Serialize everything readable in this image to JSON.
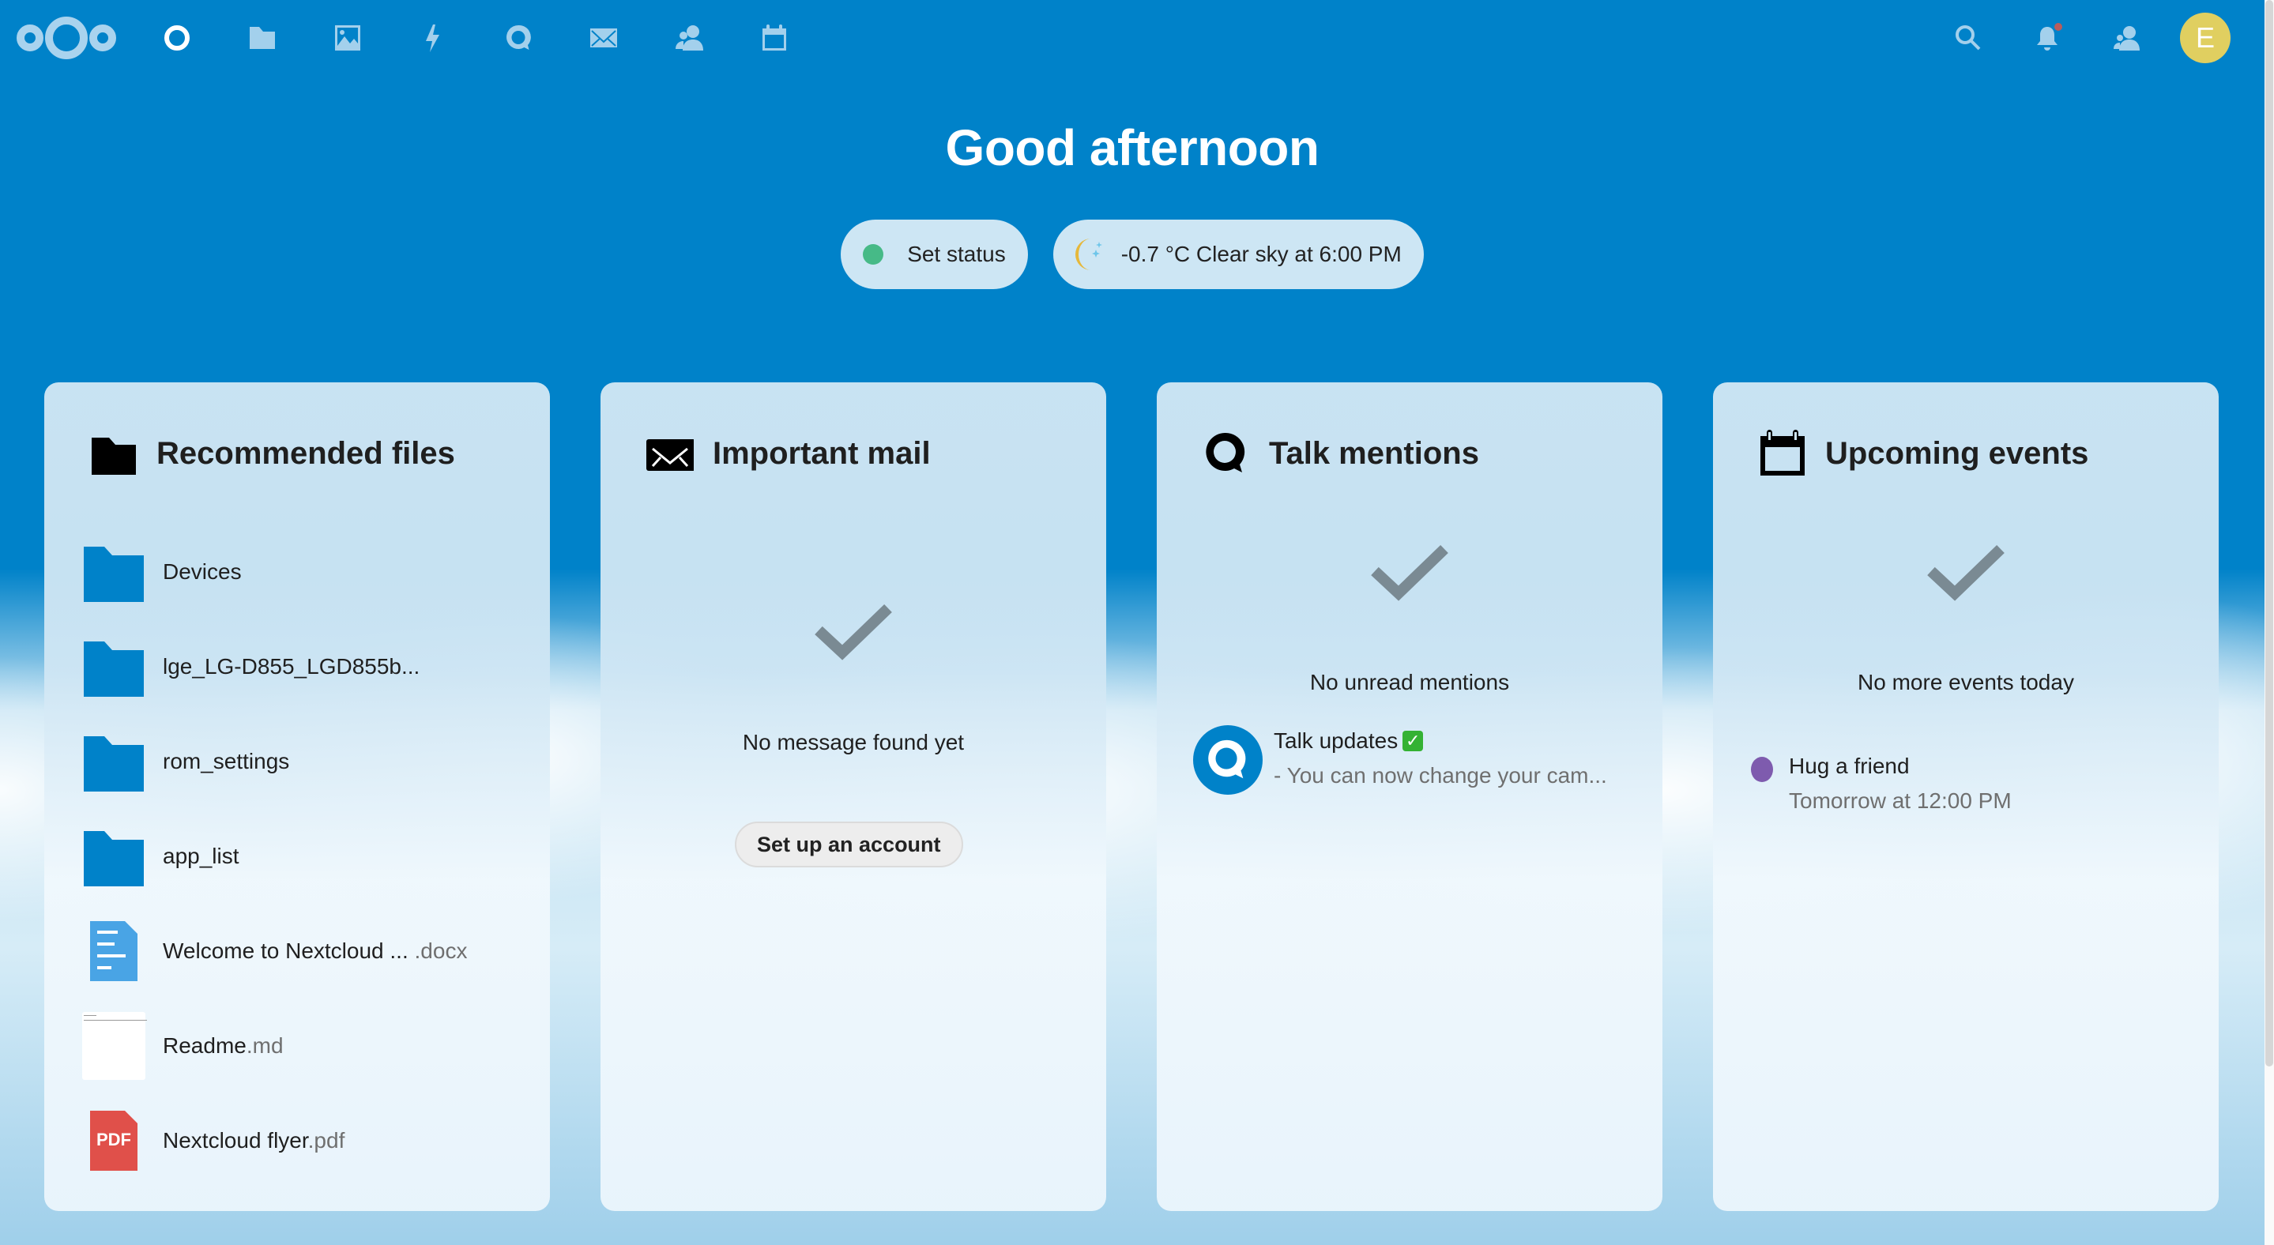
{
  "header": {
    "logo": "nextcloud-logo",
    "apps": [
      {
        "name": "Dashboard",
        "icon": "dashboard-icon",
        "active": true
      },
      {
        "name": "Files",
        "icon": "folder-icon"
      },
      {
        "name": "Photos",
        "icon": "image-icon"
      },
      {
        "name": "Activity",
        "icon": "lightning-icon"
      },
      {
        "name": "Talk",
        "icon": "talk-icon"
      },
      {
        "name": "Mail",
        "icon": "mail-icon"
      },
      {
        "name": "Contacts",
        "icon": "contacts-icon"
      },
      {
        "name": "Calendar",
        "icon": "calendar-icon"
      }
    ],
    "right": {
      "search": "search-icon",
      "notifications": "bell-icon",
      "contacts_menu": "contacts-icon",
      "avatar_initial": "E"
    }
  },
  "greeting": "Good afternoon",
  "status": {
    "label": "Set status",
    "dot_color": "#46ba87"
  },
  "weather": {
    "label": "-0.7 °C Clear sky at 6:00 PM",
    "icon": "moon-stars-icon"
  },
  "widgets": {
    "files": {
      "title": "Recommended files",
      "items": [
        {
          "name": "Devices",
          "ext": "",
          "type": "folder"
        },
        {
          "name": "lge_LG-D855_LGD855b...",
          "ext": "",
          "type": "folder"
        },
        {
          "name": "rom_settings",
          "ext": "",
          "type": "folder"
        },
        {
          "name": "app_list",
          "ext": "",
          "type": "folder"
        },
        {
          "name": "Welcome to Nextcloud ...",
          "ext": " .docx",
          "type": "document"
        },
        {
          "name": "Readme",
          "ext": ".md",
          "type": "markdown"
        },
        {
          "name": "Nextcloud flyer",
          "ext": ".pdf",
          "type": "pdf"
        }
      ],
      "pdf_label": "PDF"
    },
    "mail": {
      "title": "Important mail",
      "empty": "No message found yet",
      "button": "Set up an account"
    },
    "talk": {
      "title": "Talk mentions",
      "empty": "No unread mentions",
      "item_title": "Talk updates",
      "item_emoji": "✓",
      "item_sub": "- You can now change your cam..."
    },
    "events": {
      "title": "Upcoming events",
      "empty": "No more events today",
      "item_title": "Hug a friend",
      "item_time": "Tomorrow at 12:00 PM",
      "item_color": "#7e5bae"
    }
  }
}
